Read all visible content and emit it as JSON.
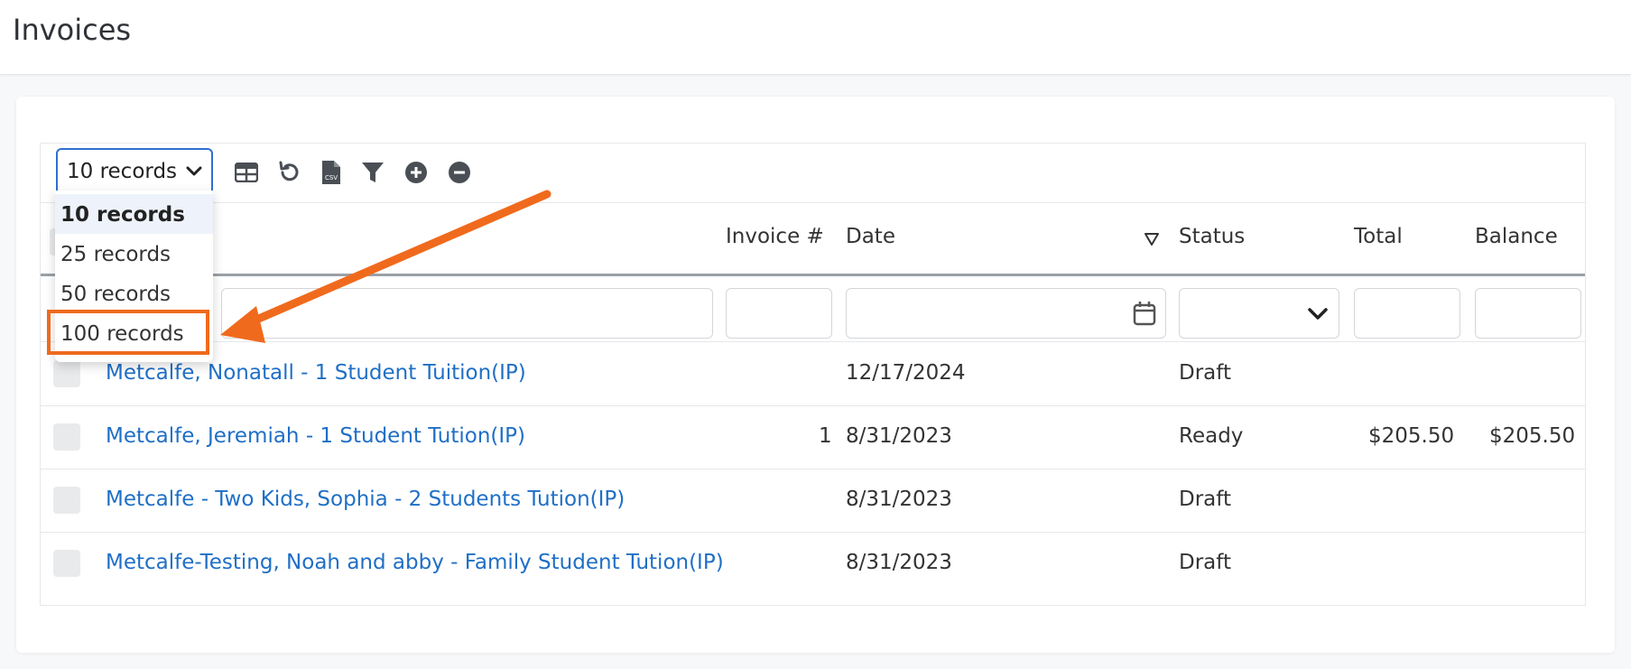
{
  "page": {
    "title": "Invoices"
  },
  "toolbar": {
    "records_select": {
      "selected": "10 records",
      "options": [
        "10 records",
        "25 records",
        "50 records",
        "100 records"
      ]
    },
    "icons": [
      "table-view-icon",
      "refresh-icon",
      "csv-export-icon",
      "filter-icon",
      "expand-all-icon",
      "collapse-all-icon"
    ]
  },
  "table": {
    "columns": [
      "Invoice #",
      "Date",
      "Status",
      "Total",
      "Balance"
    ],
    "rows": [
      {
        "name": "Metcalfe, Nonatall - 1 Student Tuition(IP)",
        "invoice": "",
        "date": "12/17/2024",
        "status": "Draft",
        "total": "",
        "balance": ""
      },
      {
        "name": "Metcalfe, Jeremiah - 1 Student Tution(IP)",
        "invoice": "1",
        "date": "8/31/2023",
        "status": "Ready",
        "total": "$205.50",
        "balance": "$205.50"
      },
      {
        "name": "Metcalfe - Two Kids, Sophia - 2 Students Tution(IP)",
        "invoice": "",
        "date": "8/31/2023",
        "status": "Draft",
        "total": "",
        "balance": ""
      },
      {
        "name": "Metcalfe-Testing, Noah and abby - Family Student Tution(IP)",
        "invoice": "",
        "date": "8/31/2023",
        "status": "Draft",
        "total": "",
        "balance": ""
      }
    ]
  },
  "annotation": {
    "color": "#f06a1d"
  },
  "colors": {
    "link": "#1f6fc6",
    "accent": "#2f6fd1"
  }
}
